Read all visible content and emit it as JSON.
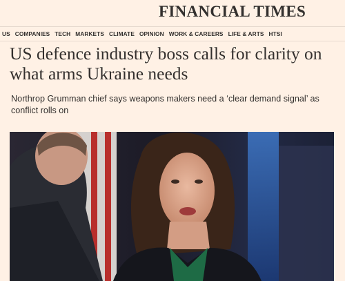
{
  "masthead": {
    "title": "FINANCIAL TIMES"
  },
  "nav": {
    "items": [
      "US",
      "COMPANIES",
      "TECH",
      "MARKETS",
      "CLIMATE",
      "OPINION",
      "WORK & CAREERS",
      "LIFE & ARTS",
      "HTSI"
    ]
  },
  "article": {
    "headline": "US defence industry boss calls for clarity on what arms Ukraine needs",
    "standfirst": "Northrop Grumman chief says weapons makers need a ‘clear demand signal’ as conflict rolls on"
  }
}
